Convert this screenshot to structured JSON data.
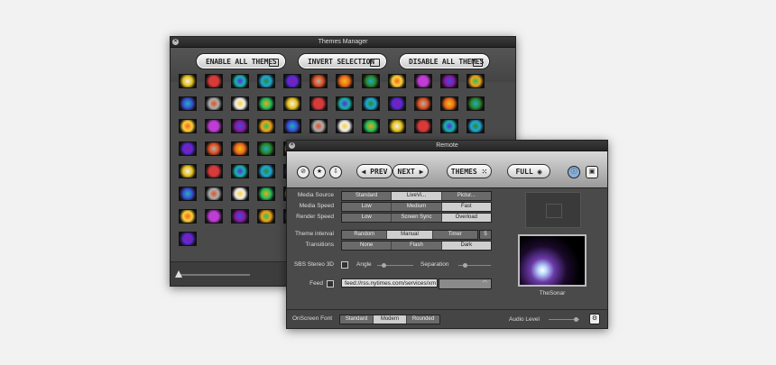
{
  "themes_manager": {
    "title": "Themes Manager",
    "close": "×",
    "buttons": {
      "enable_all": "ENABLE ALL THEMES",
      "invert": "INVERT SELECTION",
      "disable_all": "DISABLE ALL THEMES"
    }
  },
  "remote": {
    "title": "Remote",
    "close": "×",
    "toolbar": {
      "prev": "◀ PREV",
      "next": "NEXT ▶",
      "themes": "THEMES",
      "full": "FULL"
    },
    "media_source": {
      "label": "Media Source",
      "options": [
        "Standard",
        "LiveVi...",
        "Pictur..."
      ],
      "selected": 1
    },
    "media_speed": {
      "label": "Media Speed",
      "options": [
        "Low",
        "Medium",
        "Fast"
      ],
      "selected": 2
    },
    "render_speed": {
      "label": "Render Speed",
      "options": [
        "Low",
        "Screen Sync",
        "Overload"
      ],
      "selected": 2
    },
    "theme_interval": {
      "label": "Theme interval",
      "options": [
        "Random",
        "Manual",
        "Timer"
      ],
      "selected": 1,
      "timer_value": "5"
    },
    "transitions": {
      "label": "Transitions",
      "options": [
        "None",
        "Flash",
        "Dark"
      ],
      "selected": 2
    },
    "sbs": {
      "label": "SBS Stereo 3D",
      "angle": "Angle",
      "separation": "Separation"
    },
    "feed": {
      "label": "Feed",
      "value": "feed://rss.nytimes.com/services/xm"
    },
    "preview_name": "TheSonar",
    "onscreen_font": {
      "label": "OnScreen Font",
      "options": [
        "Standard",
        "Modern",
        "Rounded"
      ],
      "selected": 1
    },
    "audio_level": {
      "label": "Audio Level",
      "value": 0.9
    }
  },
  "colors": {
    "window_bg": "#4a4a4a",
    "thumb_palette": [
      "#c03cd6",
      "#e8c21a",
      "#2a8a2a",
      "#f0f0f0",
      "#e05020",
      "#3a4fd8",
      "#1fa8d8",
      "#8a1aa8",
      "#d83a3a",
      "#ffd23a",
      "#26c05a",
      "#f06a1a",
      "#b0b0b0",
      "#5a2ad8",
      "#f2a51a",
      "#18b8b0"
    ]
  }
}
